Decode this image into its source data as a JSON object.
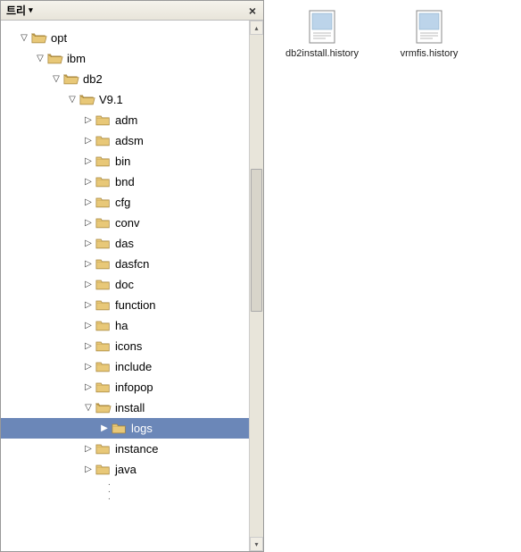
{
  "panel": {
    "title": "트리",
    "close": "×"
  },
  "tree": [
    {
      "depth": 0,
      "expander": "▽",
      "open": true,
      "label": "opt",
      "selected": false
    },
    {
      "depth": 1,
      "expander": "▽",
      "open": true,
      "label": "ibm",
      "selected": false
    },
    {
      "depth": 2,
      "expander": "▽",
      "open": true,
      "label": "db2",
      "selected": false
    },
    {
      "depth": 3,
      "expander": "▽",
      "open": true,
      "label": "V9.1",
      "selected": false
    },
    {
      "depth": 4,
      "expander": "▷",
      "open": false,
      "label": "adm",
      "selected": false
    },
    {
      "depth": 4,
      "expander": "▷",
      "open": false,
      "label": "adsm",
      "selected": false
    },
    {
      "depth": 4,
      "expander": "▷",
      "open": false,
      "label": "bin",
      "selected": false
    },
    {
      "depth": 4,
      "expander": "▷",
      "open": false,
      "label": "bnd",
      "selected": false
    },
    {
      "depth": 4,
      "expander": "▷",
      "open": false,
      "label": "cfg",
      "selected": false
    },
    {
      "depth": 4,
      "expander": "▷",
      "open": false,
      "label": "conv",
      "selected": false
    },
    {
      "depth": 4,
      "expander": "▷",
      "open": false,
      "label": "das",
      "selected": false
    },
    {
      "depth": 4,
      "expander": "▷",
      "open": false,
      "label": "dasfcn",
      "selected": false
    },
    {
      "depth": 4,
      "expander": "▷",
      "open": false,
      "label": "doc",
      "selected": false
    },
    {
      "depth": 4,
      "expander": "▷",
      "open": false,
      "label": "function",
      "selected": false
    },
    {
      "depth": 4,
      "expander": "▷",
      "open": false,
      "label": "ha",
      "selected": false
    },
    {
      "depth": 4,
      "expander": "▷",
      "open": false,
      "label": "icons",
      "selected": false
    },
    {
      "depth": 4,
      "expander": "▷",
      "open": false,
      "label": "include",
      "selected": false
    },
    {
      "depth": 4,
      "expander": "▷",
      "open": false,
      "label": "infopop",
      "selected": false
    },
    {
      "depth": 4,
      "expander": "▽",
      "open": true,
      "label": "install",
      "selected": false
    },
    {
      "depth": 5,
      "expander": "▶",
      "open": false,
      "label": "logs",
      "selected": true
    },
    {
      "depth": 4,
      "expander": "▷",
      "open": false,
      "label": "instance",
      "selected": false
    },
    {
      "depth": 4,
      "expander": "▷",
      "open": false,
      "label": "java",
      "selected": false
    }
  ],
  "files": [
    {
      "name": "db2install.history"
    },
    {
      "name": "vrmfis.history"
    }
  ]
}
